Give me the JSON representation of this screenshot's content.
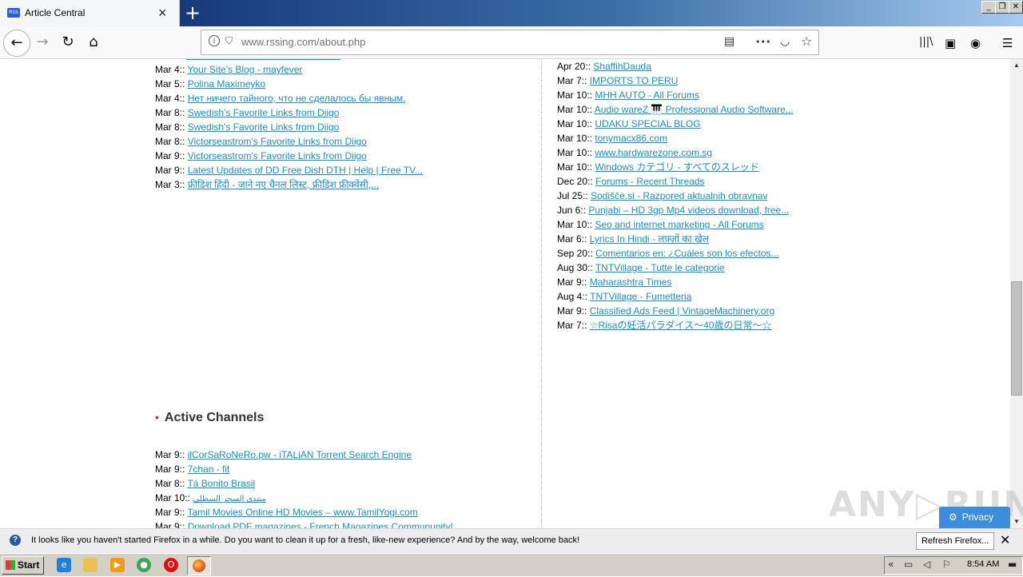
{
  "browser": {
    "tab_title": "Article Central",
    "favicon_text": "RSS",
    "url": "www.rssing.com/about.php"
  },
  "icons": {
    "tab_close": "×",
    "new_tab": "+",
    "back": "←",
    "forward": "→",
    "reload": "↻",
    "home": "⌂",
    "info": "i",
    "shield": "⛉",
    "reader": "▤",
    "more": "•••",
    "pocket": "◡",
    "star": "☆",
    "library": "|||\\",
    "sidebar": "▣",
    "account": "◉",
    "menu": "☰",
    "win_min": "_",
    "win_restore": "❐",
    "win_close": "✕",
    "scroll_up": "▲",
    "scroll_down": "▼",
    "gear": "⚙",
    "notif_question": "?",
    "notif_close": "✕"
  },
  "left_feeds": [
    {
      "date": "Mar 4::",
      "title": "Your Site's Blog - mayfever"
    },
    {
      "date": "Mar 5::",
      "title": "Polina Maximeyko"
    },
    {
      "date": "Mar 4::",
      "title": "Нет ничего тайного, что не сделалось бы явным."
    },
    {
      "date": "Mar 8::",
      "title": "Swedish's Favorite Links from Diigo"
    },
    {
      "date": "Mar 8::",
      "title": "Swedish's Favorite Links from Diigo"
    },
    {
      "date": "Mar 8::",
      "title": "Victorseastrom's Favorite Links from Diigo"
    },
    {
      "date": "Mar 9::",
      "title": "Victorseastrom's Favorite Links from Diigo"
    },
    {
      "date": "Mar 9::",
      "title": "Latest Updates of DD Free Dish DTH | Help | Free TV..."
    },
    {
      "date": "Mar 3::",
      "title": "फ्रीडिश हिंदी - जाने नए चैनल लिस्ट, फ्रीडिश फ्रीक्वेंसी,..."
    }
  ],
  "right_feeds": [
    {
      "date": "Apr 20::",
      "title": "ShaffihDauda"
    },
    {
      "date": "Mar 7::",
      "title": "IMPORTS TO PERU"
    },
    {
      "date": "Mar 10::",
      "title": "MHH AUTO - All Forums"
    },
    {
      "date": "Mar 10::",
      "title": "Audio wareZ 🎹 Professional Audio Software..."
    },
    {
      "date": "Mar 10::",
      "title": "UDAKU SPECIAL BLOG"
    },
    {
      "date": "Mar 10::",
      "title": "tonymacx86.com"
    },
    {
      "date": "Mar 10::",
      "title": "www.hardwarezone.com.sg"
    },
    {
      "date": "Mar 10::",
      "title": "Windows カテゴリ - すべてのスレッド"
    },
    {
      "date": "Dec 20::",
      "title": "Forums - Recent Threads"
    },
    {
      "date": "Jul 25::",
      "title": "Sodišče.si - Razpored aktualnih obravnav"
    },
    {
      "date": "Jun 6::",
      "title": "Punjabi – HD 3gp Mp4 videos download, free..."
    },
    {
      "date": "Mar 10::",
      "title": "Seo and internet marketing - All Forums"
    },
    {
      "date": "Mar 6::",
      "title": "Lyrics In Hindi - लफ़्ज़ों का खेल"
    },
    {
      "date": "Sep 20::",
      "title": "Comentarios en: ¿Cuáles son los efectos..."
    },
    {
      "date": "Aug 30::",
      "title": "TNTVillage - Tutte le categorie"
    },
    {
      "date": "Mar 9::",
      "title": "Maharashtra Times"
    },
    {
      "date": "Aug 4::",
      "title": "TNTVillage - Fumetteria"
    },
    {
      "date": "Mar 9::",
      "title": "Classified Ads Feed | VintageMachinery.org"
    },
    {
      "date": "Mar 7::",
      "title": "☆Risaの妊活パラダイス～40歳の日常～☆"
    }
  ],
  "active_channels": {
    "heading": "Active Channels",
    "bullet": "•",
    "items": [
      {
        "date": "Mar 9::",
        "title": "ilCorSaRoNeRo.pw - iTALiAN Torrent Search Engine"
      },
      {
        "date": "Mar 9::",
        "title": "7chan - fit"
      },
      {
        "date": "Mar 8::",
        "title": "Tá Bonito Brasil"
      },
      {
        "date": "Mar 10::",
        "title": "منتدى السحر السطلي"
      },
      {
        "date": "Mar 9::",
        "title": "Tamil Movies Online HD Movies – www.TamilYogi.com"
      },
      {
        "date": "Mar 9::",
        "title": "Download PDF magazines - French Magazines Commununity!"
      }
    ]
  },
  "privacy_button": {
    "label": "Privacy"
  },
  "watermark": "ANY▷RUN",
  "notification": {
    "message": "It looks like you haven't started Firefox in a while. Do you want to clean it up for a fresh, like-new experience? And by the way, welcome back!",
    "refresh_label": "Refresh Firefox..."
  },
  "taskbar": {
    "start_label": "Start",
    "clock": "8:54 AM",
    "tray_chevron": "«"
  },
  "colors": {
    "link": "#1a8fd0",
    "privacy_bg": "#3d8ddc",
    "bullet": "#c0392b"
  }
}
